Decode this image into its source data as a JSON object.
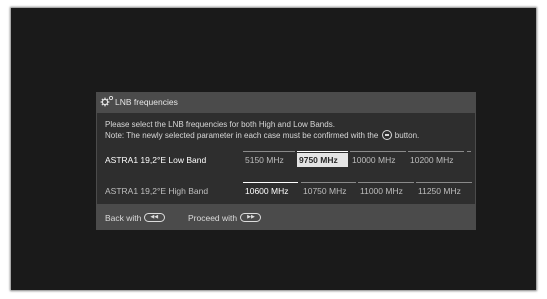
{
  "dialog": {
    "title": "LNB frequencies",
    "title_icon": "gear-icon",
    "info_line1": "Please select the LNB frequencies for both High and Low Bands.",
    "info_line2_before": "Note: The newly selected parameter in each case must be confirmed with the",
    "info_line2_after": "button.",
    "info_icon": "ok-button-icon"
  },
  "rows": [
    {
      "label": "ASTRA1 19,2°E Low Band",
      "options": [
        "5150 MHz",
        "9750 MHz",
        "10000 MHz",
        "10200 MHz"
      ],
      "selected": "9750 MHz",
      "active": true
    },
    {
      "label": "ASTRA1 19,2°E High Band",
      "options": [
        "10600 MHz",
        "10750 MHz",
        "11000 MHz",
        "11250 MHz"
      ],
      "selected": "10600 MHz",
      "active": false
    }
  ],
  "footer": {
    "back_label": "Back with",
    "back_icon": "rewind-button-icon",
    "proceed_label": "Proceed with",
    "proceed_icon": "fast-forward-button-icon"
  },
  "colors": {
    "screen_background": "#1a1a1a",
    "dialog_frame": "#4b4b4b",
    "dialog_body": "#2e2e2e",
    "selected_option_background": "#e4e4e4"
  }
}
